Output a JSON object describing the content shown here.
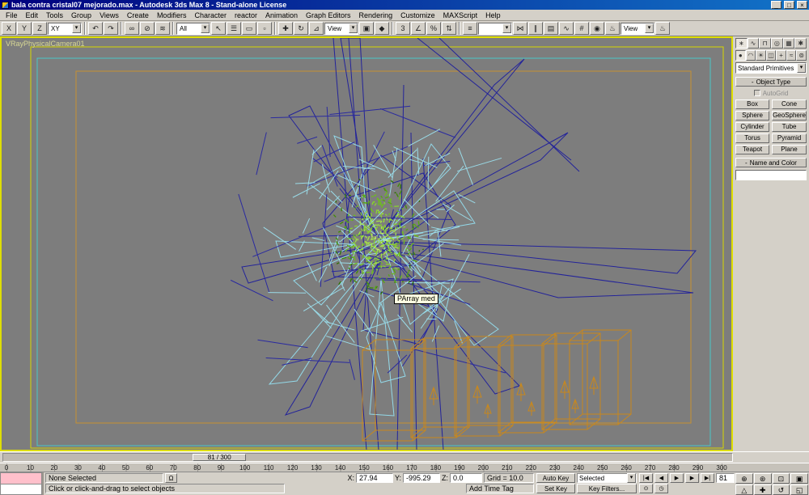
{
  "window": {
    "title": "bala contra cristal07 mejorado.max - Autodesk 3ds Max 8 - Stand-alone License",
    "minimize": "_",
    "maximize": "□",
    "close": "×"
  },
  "menu": {
    "items": [
      "File",
      "Edit",
      "Tools",
      "Group",
      "Views",
      "Create",
      "Modifiers",
      "Character",
      "reactor",
      "Animation",
      "Graph Editors",
      "Rendering",
      "Customize",
      "MAXScript",
      "Help"
    ]
  },
  "toolbar": {
    "items": [
      {
        "kind": "btn",
        "name": "axis-constraint-x",
        "glyph": "X"
      },
      {
        "kind": "btn",
        "name": "axis-constraint-y",
        "glyph": "Y"
      },
      {
        "kind": "btn",
        "name": "axis-constraint-z",
        "glyph": "Z"
      },
      {
        "kind": "dd",
        "name": "axis-constraint-plane",
        "glyph": "XY"
      },
      {
        "kind": "sep"
      },
      {
        "kind": "btn",
        "name": "undo",
        "glyph": "↶"
      },
      {
        "kind": "btn",
        "name": "redo",
        "glyph": "↷"
      },
      {
        "kind": "sep"
      },
      {
        "kind": "btn",
        "name": "select-and-link",
        "glyph": "∞"
      },
      {
        "kind": "btn",
        "name": "unlink-selection",
        "glyph": "⊘"
      },
      {
        "kind": "btn",
        "name": "bind-to-space-warp",
        "glyph": "≋"
      },
      {
        "kind": "sep"
      },
      {
        "kind": "dd",
        "name": "selection-filter",
        "glyph": "All"
      },
      {
        "kind": "btn",
        "name": "select-object",
        "glyph": "↖"
      },
      {
        "kind": "btn",
        "name": "select-by-name",
        "glyph": "☰"
      },
      {
        "kind": "btn",
        "name": "rectangular-selection-region",
        "glyph": "▭"
      },
      {
        "kind": "btn",
        "name": "window-crossing-toggle",
        "glyph": "▫"
      },
      {
        "kind": "sep"
      },
      {
        "kind": "btn",
        "name": "select-and-move",
        "glyph": "✚"
      },
      {
        "kind": "btn",
        "name": "select-and-rotate",
        "glyph": "↻"
      },
      {
        "kind": "btn",
        "name": "select-and-uniform-scale",
        "glyph": "⊿"
      },
      {
        "kind": "dd",
        "name": "reference-coordinate-system",
        "glyph": "View"
      },
      {
        "kind": "btn",
        "name": "use-pivot-point-center",
        "glyph": "▣"
      },
      {
        "kind": "btn",
        "name": "select-and-manipulate",
        "glyph": "◆"
      },
      {
        "kind": "sep"
      },
      {
        "kind": "btn",
        "name": "snaps-toggle",
        "glyph": "3"
      },
      {
        "kind": "btn",
        "name": "angle-snap-toggle",
        "glyph": "∠"
      },
      {
        "kind": "btn",
        "name": "percent-snap-toggle",
        "glyph": "%"
      },
      {
        "kind": "btn",
        "name": "spinner-snap-toggle",
        "glyph": "⇅"
      },
      {
        "kind": "sep"
      },
      {
        "kind": "btn",
        "name": "edit-named-selection-sets",
        "glyph": "≡"
      },
      {
        "kind": "dd",
        "name": "named-selection-sets",
        "glyph": ""
      },
      {
        "kind": "btn",
        "name": "mirror",
        "glyph": "⋈"
      },
      {
        "kind": "btn",
        "name": "align",
        "glyph": "∥"
      },
      {
        "kind": "btn",
        "name": "layer-manager",
        "glyph": "▤"
      },
      {
        "kind": "btn",
        "name": "curve-editor",
        "glyph": "∿"
      },
      {
        "kind": "btn",
        "name": "schematic-view",
        "glyph": "#"
      },
      {
        "kind": "btn",
        "name": "material-editor",
        "glyph": "◉"
      },
      {
        "kind": "btn",
        "name": "render-scene-dialog",
        "glyph": "♨"
      },
      {
        "kind": "dd",
        "name": "render-type",
        "glyph": "View"
      },
      {
        "kind": "btn",
        "name": "quick-render",
        "glyph": "♨"
      }
    ]
  },
  "viewport": {
    "label": "VRayPhysicalCamera01",
    "tooltip": "PArray med"
  },
  "command_panel": {
    "tabs": [
      {
        "name": "tab-create",
        "glyph": "∗"
      },
      {
        "name": "tab-modify",
        "glyph": "∿"
      },
      {
        "name": "tab-hierarchy",
        "glyph": "⊓"
      },
      {
        "name": "tab-motion",
        "glyph": "◎"
      },
      {
        "name": "tab-display",
        "glyph": "▦"
      },
      {
        "name": "tab-utilities",
        "glyph": "✱"
      }
    ],
    "categories": [
      {
        "name": "category-geometry",
        "glyph": "●"
      },
      {
        "name": "category-shapes",
        "glyph": "◠"
      },
      {
        "name": "category-lights",
        "glyph": "☀"
      },
      {
        "name": "category-cameras",
        "glyph": "◫"
      },
      {
        "name": "category-helpers",
        "glyph": "+"
      },
      {
        "name": "category-space-warps",
        "glyph": "≈"
      },
      {
        "name": "category-systems",
        "glyph": "⊚"
      }
    ],
    "primitives_dropdown": "Standard Primitives",
    "rollout_object_type": "Object Type",
    "autogrid": "AutoGrid",
    "object_buttons": [
      "Box",
      "Cone",
      "Sphere",
      "GeoSphere",
      "Cylinder",
      "Tube",
      "Torus",
      "Pyramid",
      "Teapot",
      "Plane"
    ],
    "rollout_name_color": "Name and Color",
    "name_field": ""
  },
  "timeline": {
    "slider_label": "81 / 300",
    "slider_pos_pct": 26,
    "ticks": [
      0,
      10,
      20,
      30,
      40,
      50,
      60,
      70,
      80,
      90,
      100,
      110,
      120,
      130,
      140,
      150,
      160,
      170,
      180,
      190,
      200,
      210,
      220,
      230,
      240,
      250,
      260,
      270,
      280,
      290,
      300
    ]
  },
  "statusbar": {
    "selection_status": "None Selected",
    "prompt": "Click or click-and-drag to select objects",
    "x_label": "X:",
    "y_label": "Y:",
    "z_label": "Z:",
    "x_value": "27.94",
    "y_value": "-995.29",
    "z_value": "0.0",
    "grid": "Grid = 10.0",
    "add_time_tag": "Add Time Tag",
    "auto_key": "Auto Key",
    "set_key": "Set Key",
    "key_mode_dropdown": "Selected",
    "key_filters": "Key Filters...",
    "frame_value": "81"
  },
  "transport": {
    "buttons": [
      {
        "name": "go-to-start",
        "glyph": "|◀"
      },
      {
        "name": "previous-frame",
        "glyph": "◀"
      },
      {
        "name": "play-animation",
        "glyph": "▶"
      },
      {
        "name": "next-frame",
        "glyph": "▶"
      },
      {
        "name": "go-to-end",
        "glyph": "▶|"
      }
    ],
    "row2": [
      {
        "name": "key-mode-toggle",
        "glyph": "⊙"
      },
      {
        "name": "time-configuration",
        "glyph": "◷"
      }
    ]
  },
  "nav": {
    "buttons": [
      {
        "name": "zoom",
        "glyph": "⊕"
      },
      {
        "name": "zoom-all",
        "glyph": "⊛"
      },
      {
        "name": "zoom-extents",
        "glyph": "⊡"
      },
      {
        "name": "zoom-extents-all",
        "glyph": "▣"
      },
      {
        "name": "field-of-view",
        "glyph": "△"
      },
      {
        "name": "pan-view",
        "glyph": "✚"
      },
      {
        "name": "arc-rotate",
        "glyph": "↺"
      },
      {
        "name": "min-max-toggle",
        "glyph": "◱"
      }
    ]
  },
  "icons": {
    "lock": "Ω",
    "chevron": "▾",
    "rollout_minus": "-"
  },
  "colors": {
    "active_viewport_border": "#dede00",
    "viewport_background": "#7d7d7d",
    "wire_navy": "#23239a",
    "wire_cyan": "#93d9e9",
    "particles_green": "#6fbf1c",
    "emitter_orange": "#c9881c",
    "safe_frame_yellow": "#d6d600",
    "safe_frame_cyan": "#49c8c8",
    "safe_frame_orange": "#c79131"
  }
}
